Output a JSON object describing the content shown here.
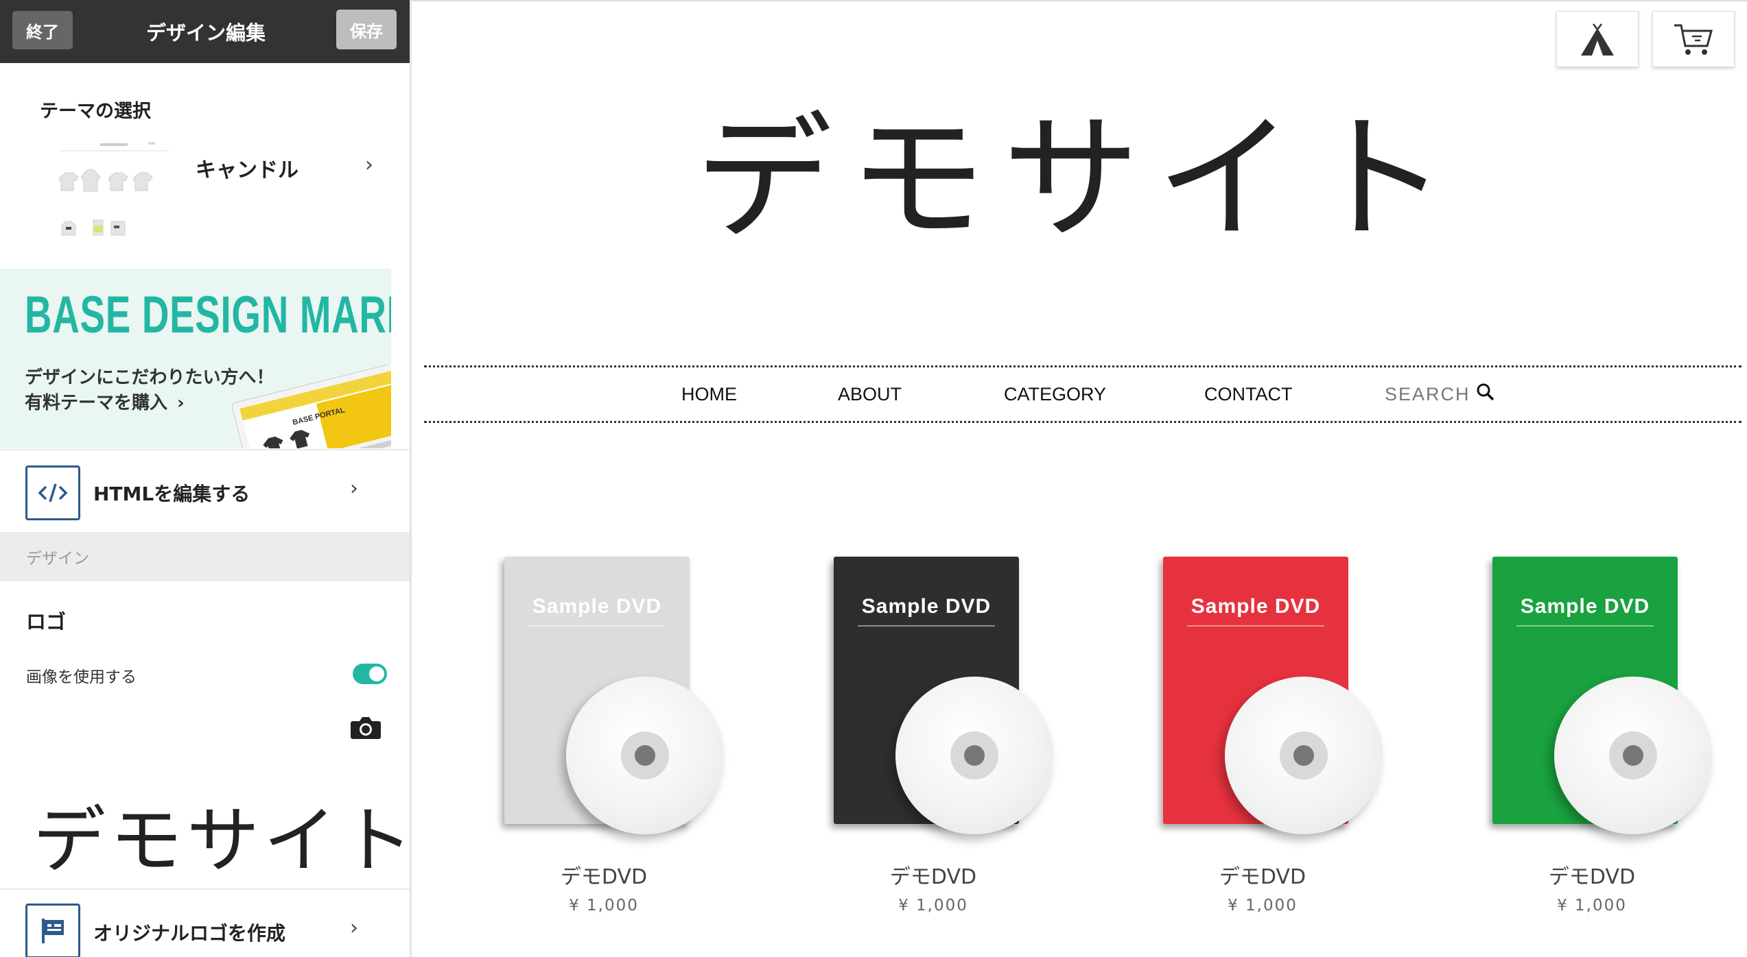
{
  "editor": {
    "exit_label": "終了",
    "title": "デザイン編集",
    "save_label": "保存"
  },
  "theme": {
    "heading": "テーマの選択",
    "name": "キャンドル",
    "chevron": "›"
  },
  "banner": {
    "logo": "BASE DESIGN MARKET",
    "line1": "デザインにこだわりたい方へ！",
    "line2": "有料テーマを購入",
    "chevron": "›",
    "screen_text": "BASE PORTAL"
  },
  "html_edit": {
    "label": "HTMLを編集する",
    "icon": "code-icon",
    "chevron": "›"
  },
  "section_design": "デザイン",
  "logo_section": {
    "heading": "ロゴ",
    "use_image_label": "画像を使用する",
    "use_image_enabled": true,
    "preview_text": "デモサイト"
  },
  "original_logo": {
    "label": "オリジナルロゴを作成",
    "icon": "flag-icon",
    "chevron": "›"
  },
  "site": {
    "title": "デモサイト",
    "nav": {
      "home": "HOME",
      "about": "ABOUT",
      "category": "CATEGORY",
      "contact": "CONTACT",
      "search": "SEARCH"
    }
  },
  "products": [
    {
      "case_label": "Sample DVD",
      "name": "デモDVD",
      "price": "¥ 1,000",
      "color": "#dcdcdc",
      "label_color": "#ffffff"
    },
    {
      "case_label": "Sample DVD",
      "name": "デモDVD",
      "price": "¥ 1,000",
      "color": "#2e2e2e",
      "label_color": "#ffffff"
    },
    {
      "case_label": "Sample DVD",
      "name": "デモDVD",
      "price": "¥ 1,000",
      "color": "#e6323e",
      "label_color": "#ffffff"
    },
    {
      "case_label": "Sample DVD",
      "name": "デモDVD",
      "price": "¥ 1,000",
      "color": "#19a23f",
      "label_color": "#ffffff"
    }
  ],
  "colors": {
    "accent": "#23b6a4",
    "topbar": "#333333",
    "icon_blue": "#2c5a8c"
  }
}
